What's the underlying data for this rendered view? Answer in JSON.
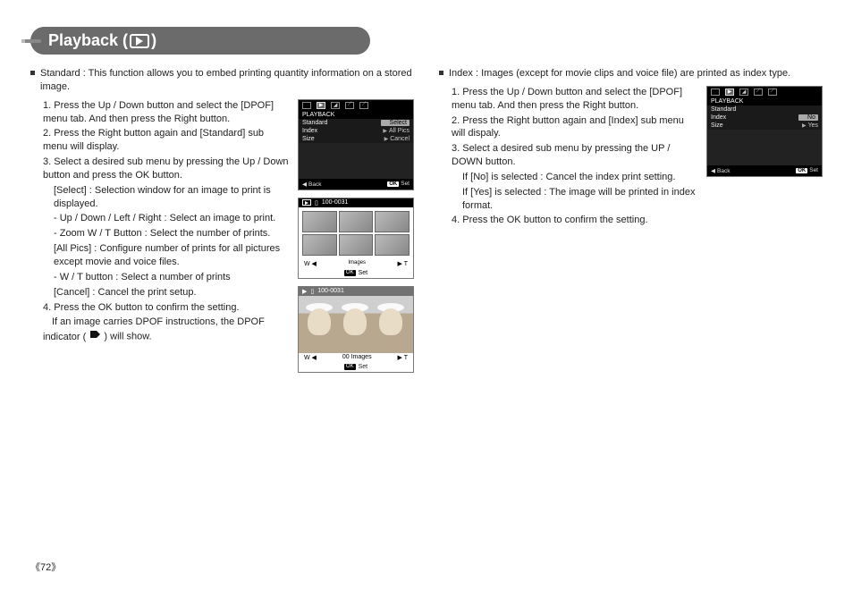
{
  "title": {
    "prefix": "Playback (",
    "suffix": ")"
  },
  "page_number": "72",
  "left": {
    "heading_label": "Standard",
    "heading_text": ": This function allows you to embed printing quantity information on a stored image.",
    "steps": {
      "s1": "1. Press the Up / Down button and select the [DPOF] menu tab. And then press the Right button.",
      "s2": "2. Press the Right button again and [Standard] sub menu will display.",
      "s3": "3. Select a desired sub menu by pressing the Up / Down button and press the OK button.",
      "s3_select": "[Select] : Selection window for an image to print is displayed.",
      "s3_udlr": "- Up / Down / Left / Right : Select an image to print.",
      "s3_zoom": "- Zoom W / T Button : Select the number of prints.",
      "s3_all": "[All Pics] : Configure number of prints for all pictures except movie and voice files.",
      "s3_wt": "- W / T button : Select a number of prints",
      "s3_cancel": "[Cancel] : Cancel the print setup.",
      "s4a": "4. Press the OK button to confirm the setting.",
      "s4b": "If an image carries DPOF instructions, the DPOF indicator (",
      "s4c": ") will show."
    },
    "screen1": {
      "section": "PLAYBACK",
      "rows": [
        {
          "l": "Standard",
          "r": "Select"
        },
        {
          "l": "Index",
          "r": "All Pics"
        },
        {
          "l": "Size",
          "r": "Cancel"
        }
      ],
      "back": "Back",
      "ok": "OK",
      "set": "Set"
    },
    "screen2": {
      "file": "100-0031",
      "images_label": "Images",
      "w": "W",
      "t": "T",
      "ok": "OK",
      "set": "Set"
    },
    "screen3": {
      "file": "100-0031",
      "count": "00",
      "images_label": "Images",
      "w": "W",
      "t": "T",
      "ok": "OK",
      "set": "Set"
    }
  },
  "right": {
    "heading_label": "Index",
    "heading_text": ": Images (except for movie clips and voice file) are printed as index type.",
    "steps": {
      "s1": "1. Press the Up / Down button and select the [DPOF] menu tab. And then press the Right button.",
      "s2": "2. Press the Right button again and [Index] sub menu will dispaly.",
      "s3": "3. Select a desired sub menu by pressing the UP / DOWN button.",
      "s3_no": "If [No] is selected    : Cancel the index print setting.",
      "s3_yes": "If [Yes] is selected  : The image will be printed in index format.",
      "s4": "4. Press the OK button to confirm the setting."
    },
    "screen1": {
      "section": "PLAYBACK",
      "rows": [
        {
          "l": "Standard",
          "r": ""
        },
        {
          "l": "Index",
          "r": "No"
        },
        {
          "l": "Size",
          "r": "Yes"
        }
      ],
      "back": "Back",
      "ok": "OK",
      "set": "Set"
    }
  }
}
